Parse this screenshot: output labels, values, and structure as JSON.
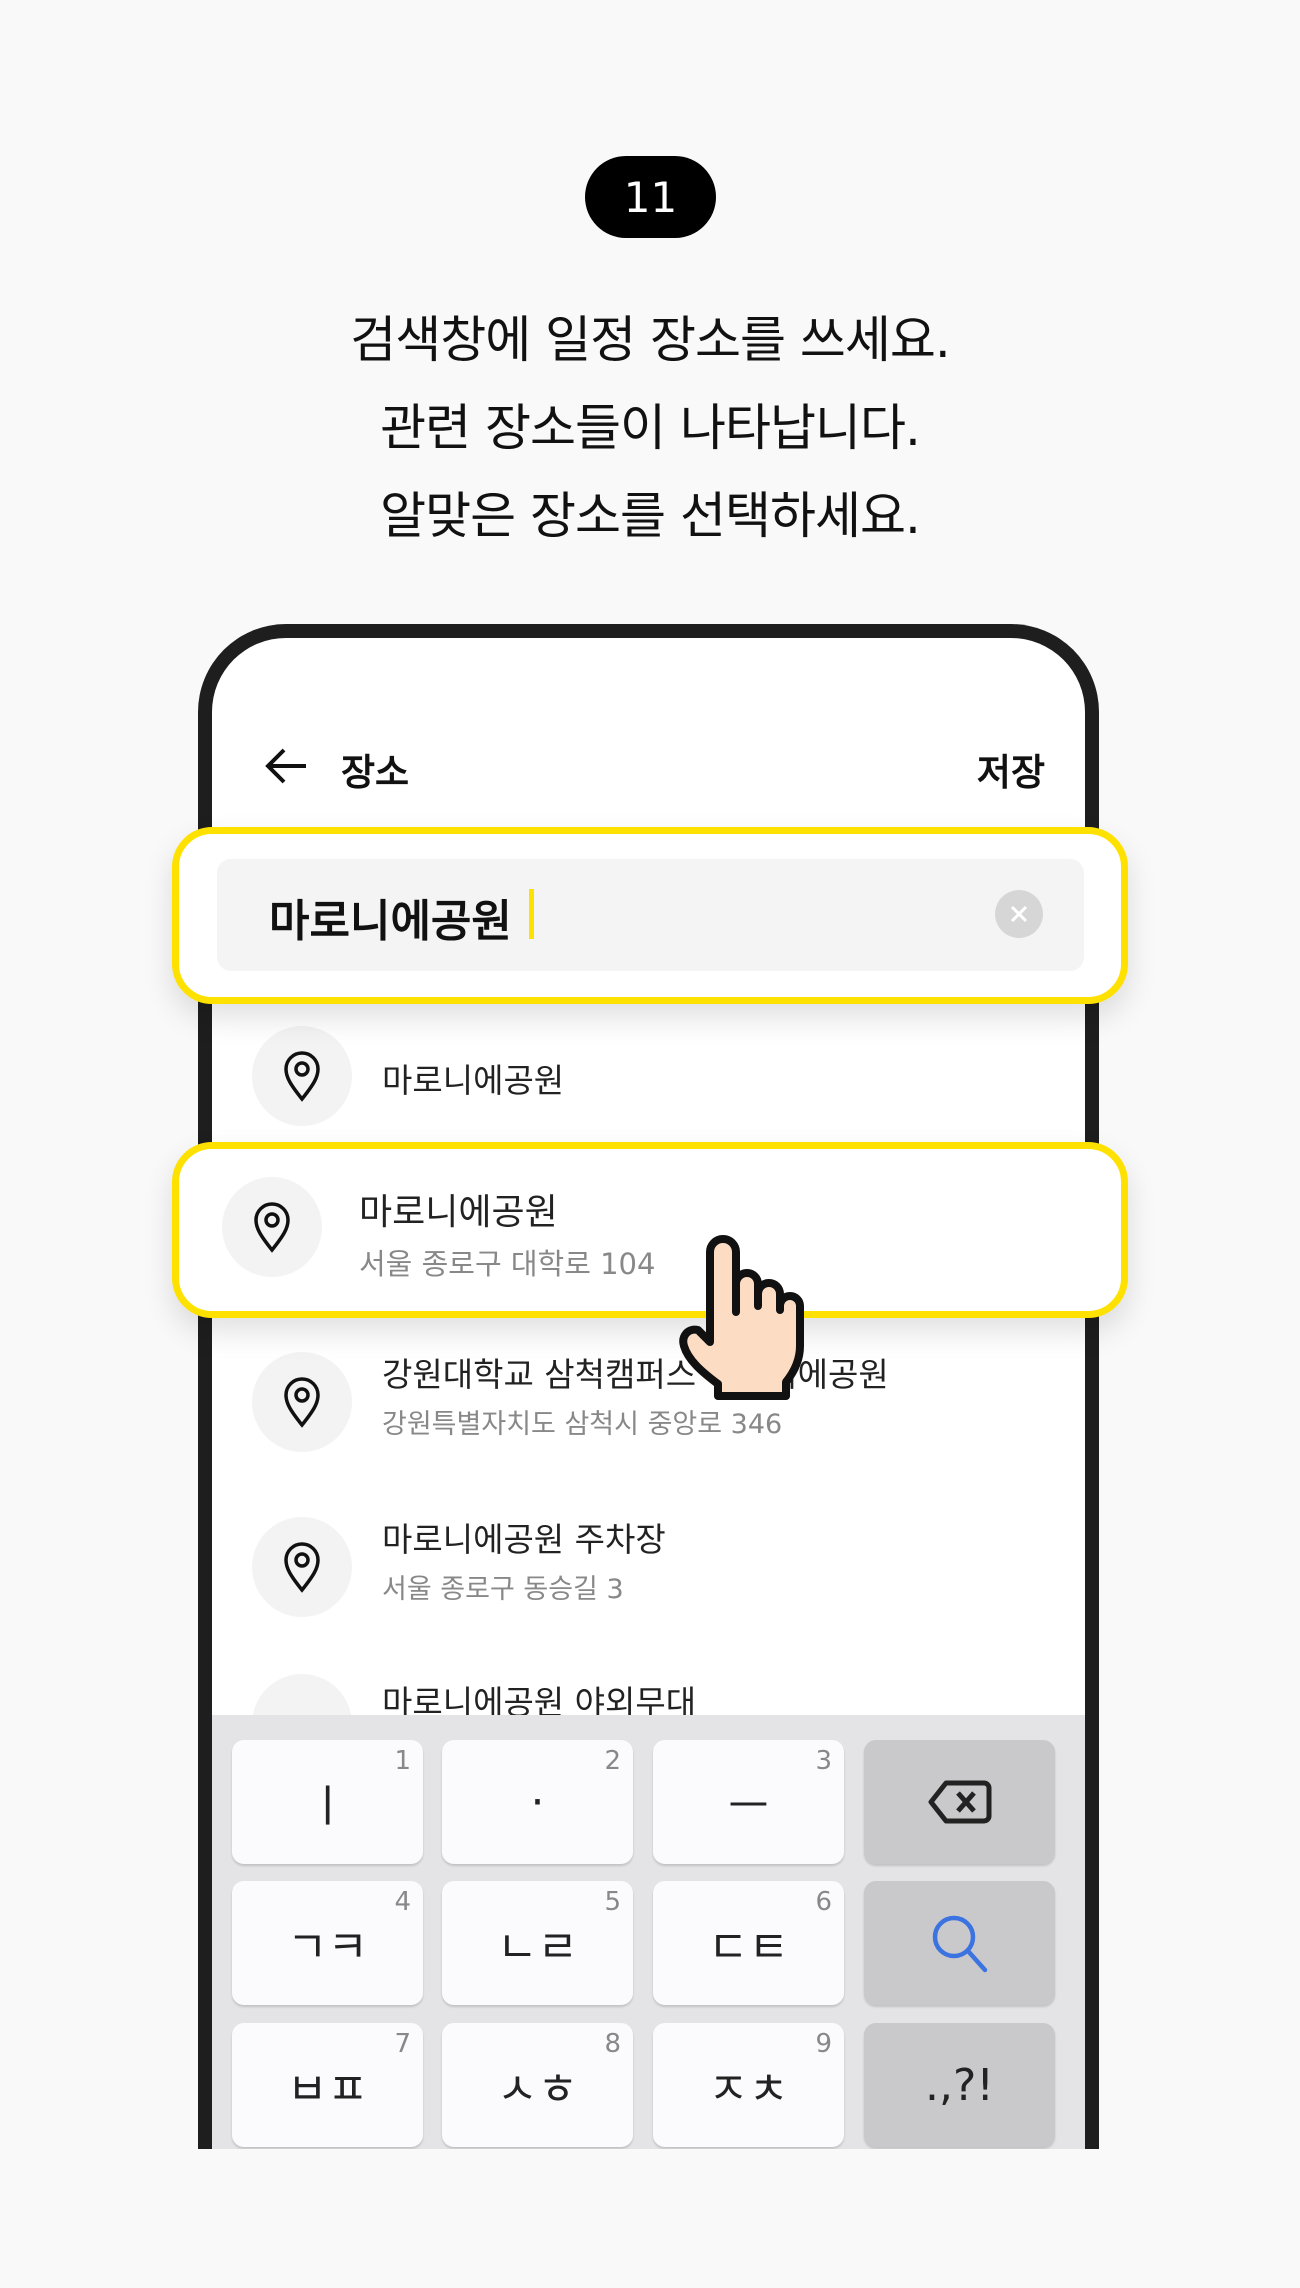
{
  "step_number": "11",
  "instructions": [
    "검색창에 일정 장소를 쓰세요.",
    "관련 장소들이 나타납니다.",
    "알맞은 장소를 선택하세요."
  ],
  "header": {
    "title": "장소",
    "save_label": "저장",
    "back_icon": "arrow-left-icon"
  },
  "search": {
    "value": "마로니에공원",
    "clear_icon": "close-circle-icon"
  },
  "results": [
    {
      "title": "마로니에공원",
      "address": ""
    },
    {
      "title": "마로니에공원",
      "address": "서울 종로구 대학로 104"
    },
    {
      "title": "강원대학교 삼척캠퍼스 마로니에공원",
      "address": "강원특별자치도 삼척시 중앙로 346"
    },
    {
      "title": "마로니에공원 주차장",
      "address": "서울 종로구 동승길 3"
    },
    {
      "title": "마로니에공원 야외무대",
      "address": ""
    }
  ],
  "keyboard": {
    "keys": [
      {
        "label": "ㅣ",
        "num": "1"
      },
      {
        "label": "·",
        "num": "2"
      },
      {
        "label": "ㅡ",
        "num": "3"
      },
      {
        "label": "",
        "icon": "backspace-icon"
      },
      {
        "label": "ㄱㅋ",
        "num": "4"
      },
      {
        "label": "ㄴㄹ",
        "num": "5"
      },
      {
        "label": "ㄷㅌ",
        "num": "6"
      },
      {
        "label": "",
        "icon": "search-icon"
      },
      {
        "label": "ㅂㅍ",
        "num": "7"
      },
      {
        "label": "ㅅㅎ",
        "num": "8"
      },
      {
        "label": "ㅈㅊ",
        "num": "9"
      },
      {
        "label": ".,?!"
      }
    ]
  },
  "colors": {
    "highlight": "#ffe100",
    "search_icon": "#3b73e0",
    "frame": "#1e1e1e"
  }
}
